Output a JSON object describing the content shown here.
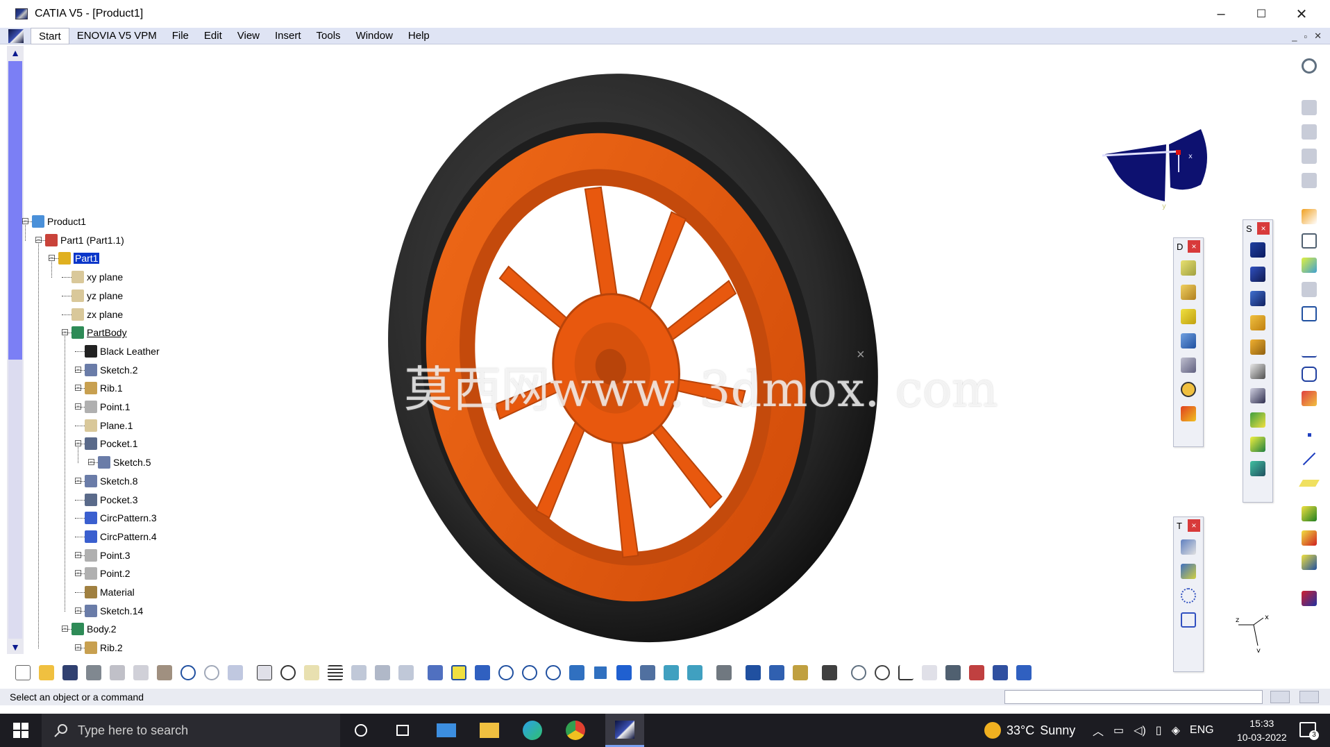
{
  "window": {
    "title": "CATIA V5 - [Product1]",
    "minimize": "–",
    "maximize": "☐",
    "close": "✕"
  },
  "menu": {
    "items": [
      "Start",
      "ENOVIA V5 VPM",
      "File",
      "Edit",
      "View",
      "Insert",
      "Tools",
      "Window",
      "Help"
    ],
    "mdi": [
      "_",
      "▫",
      "✕"
    ]
  },
  "tree": {
    "nodes": [
      {
        "label": "Product1",
        "icon": "product-icon",
        "color": "#4a90d9"
      },
      {
        "label": "Part1 (Part1.1)",
        "icon": "part-instance-icon",
        "color": "#c9433a"
      },
      {
        "label": "Part1",
        "icon": "part-icon",
        "color": "#e0b020",
        "selected": true
      },
      {
        "label": "xy plane",
        "icon": "plane-icon",
        "color": "#d9c89a"
      },
      {
        "label": "yz plane",
        "icon": "plane-icon",
        "color": "#d9c89a"
      },
      {
        "label": "zx plane",
        "icon": "plane-icon",
        "color": "#d9c89a"
      },
      {
        "label": "PartBody",
        "icon": "body-icon",
        "color": "#2e8b57",
        "underline": true
      },
      {
        "label": "Black Leather",
        "icon": "material-icon",
        "color": "#222222"
      },
      {
        "label": "Sketch.2",
        "icon": "sketch-icon",
        "color": "#6a7ca8"
      },
      {
        "label": "Rib.1",
        "icon": "rib-icon",
        "color": "#c8a050"
      },
      {
        "label": "Point.1",
        "icon": "point-icon",
        "color": "#b0b0b0"
      },
      {
        "label": "Plane.1",
        "icon": "plane-icon",
        "color": "#d9c89a"
      },
      {
        "label": "Pocket.1",
        "icon": "pocket-icon",
        "color": "#5a6a8a"
      },
      {
        "label": "Sketch.5",
        "icon": "sketch-icon",
        "color": "#6a7ca8"
      },
      {
        "label": "Sketch.8",
        "icon": "sketch-icon",
        "color": "#6a7ca8"
      },
      {
        "label": "Pocket.3",
        "icon": "pocket-icon",
        "color": "#5a6a8a"
      },
      {
        "label": "CircPattern.3",
        "icon": "pattern-icon",
        "color": "#3a5fcf"
      },
      {
        "label": "CircPattern.4",
        "icon": "pattern-icon",
        "color": "#3a5fcf"
      },
      {
        "label": "Point.3",
        "icon": "point-icon",
        "color": "#b0b0b0"
      },
      {
        "label": "Point.2",
        "icon": "point-icon",
        "color": "#b0b0b0"
      },
      {
        "label": "Material",
        "icon": "material-icon",
        "color": "#a08040"
      },
      {
        "label": "Sketch.14",
        "icon": "sketch-icon",
        "color": "#6a7ca8"
      },
      {
        "label": "Body.2",
        "icon": "body-icon",
        "color": "#2e8b57"
      },
      {
        "label": "Rib.2",
        "icon": "rib-icon",
        "color": "#c8a050"
      }
    ]
  },
  "viewport": {
    "watermark": "莫西网www. 3dmox. com",
    "tire_color": "#1c1c1c",
    "rim_color": "#e85a0f"
  },
  "toolbars": {
    "float1_title": "D",
    "float2_title": "S",
    "float3_title": "T",
    "close": "×"
  },
  "compass": {
    "x": "x",
    "y": "y",
    "z": "z"
  },
  "statusbar": {
    "message": "Select an object or a command"
  },
  "taskbar": {
    "search_placeholder": "Type here to search",
    "weather_temp": "33°C",
    "weather_desc": "Sunny",
    "lang": "ENG",
    "time": "15:33",
    "date": "10-03-2022",
    "notif_count": "3"
  }
}
